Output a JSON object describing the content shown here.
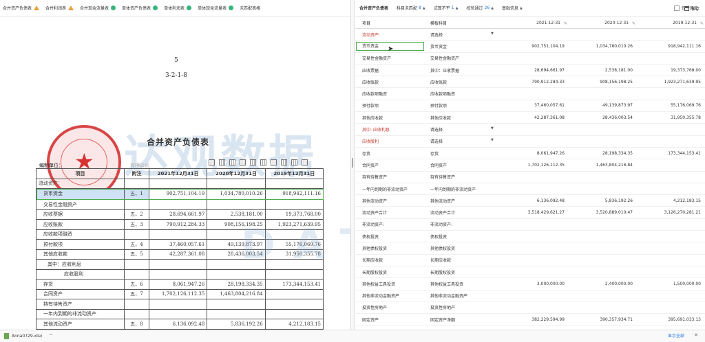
{
  "left_tabs": [
    {
      "label": "合并资产负债表",
      "status": "warning-icon"
    },
    {
      "label": "合并利润表",
      "status": "warning-icon"
    },
    {
      "label": "合并现金流量表",
      "status": "check-icon"
    },
    {
      "label": "单体资产负债表",
      "status": "check-icon"
    },
    {
      "label": "单体利润表",
      "status": "check-icon"
    },
    {
      "label": "单体现金流量表",
      "status": "check-icon"
    },
    {
      "label": "未匹配表格",
      "status": ""
    }
  ],
  "only_original_label": "仅看原文",
  "document": {
    "page_number": "5",
    "page_sub": "3-2-1-8",
    "title": "合并资产负债表",
    "compiled_by": "编制单位：",
    "company_suffix": "有限公司",
    "stamp_number": "3301081080123",
    "headers": [
      "项目",
      "附注",
      "2021年12月31日",
      "2020年12月31日",
      "2019年12月31日"
    ],
    "rows": [
      {
        "item": "流动资产：",
        "note": "",
        "v2021": "",
        "v2020": "",
        "v2019": ""
      },
      {
        "item": "货币资金",
        "note": "五、1",
        "v2021": "902,751,104.19",
        "v2020": "1,034,780,010.26",
        "v2019": "918,942,111.16"
      },
      {
        "item": "交易性金融资产",
        "note": "",
        "v2021": "",
        "v2020": "",
        "v2019": ""
      },
      {
        "item": "应收票据",
        "note": "五、2",
        "v2021": "28,694,661.97",
        "v2020": "2,538,181.00",
        "v2019": "19,373,768.00"
      },
      {
        "item": "应收账款",
        "note": "五、3",
        "v2021": "790,912,284.33",
        "v2020": "908,156,198.25",
        "v2019": "1,923,271,639.95"
      },
      {
        "item": "应收款项融资",
        "note": "",
        "v2021": "",
        "v2020": "",
        "v2019": ""
      },
      {
        "item": "预付款项",
        "note": "五、4",
        "v2021": "37,460,057.61",
        "v2020": "49,139,873.97",
        "v2019": "55,176,069.76"
      },
      {
        "item": "其他应收款",
        "note": "五、5",
        "v2021": "42,287,361.08",
        "v2020": "28,436,003.54",
        "v2019": "31,950,355.78"
      },
      {
        "item": "其中：应收利息",
        "note": "",
        "v2021": "",
        "v2020": "",
        "v2019": ""
      },
      {
        "item": "应收股利",
        "note": "",
        "v2021": "",
        "v2020": "",
        "v2019": ""
      },
      {
        "item": "存货",
        "note": "五、6",
        "v2021": "8,061,947.26",
        "v2020": "28,198,334.35",
        "v2019": "173,344,153.41"
      },
      {
        "item": "合同资产",
        "note": "五、7",
        "v2021": "1,702,126,112.35",
        "v2020": "1,463,804,216.84",
        "v2019": ""
      },
      {
        "item": "持有待售资产",
        "note": "",
        "v2021": "",
        "v2020": "",
        "v2019": ""
      },
      {
        "item": "一年内到期的非流动资产",
        "note": "",
        "v2021": "",
        "v2020": "",
        "v2019": ""
      },
      {
        "item": "其他流动资产",
        "note": "五、8",
        "v2021": "6,136,092.48",
        "v2020": "5,836,192.26",
        "v2019": "4,212,183.15"
      }
    ]
  },
  "watermark": {
    "line1": "达观数据",
    "line2": "DATAGRAND"
  },
  "right_tabs": [
    {
      "label": "合并资产负债表",
      "active": true,
      "caret": false,
      "count": ""
    },
    {
      "label": "科目未匹配",
      "active": false,
      "caret": true,
      "count": "8"
    },
    {
      "label": "试算不平",
      "active": false,
      "caret": true,
      "count": "1"
    },
    {
      "label": "校验通过",
      "active": false,
      "caret": true,
      "count": "26"
    },
    {
      "label": "基础信息",
      "active": false,
      "caret": true,
      "count": ""
    }
  ],
  "save_label": "保存",
  "right_headers": [
    "项目",
    "模板科目",
    "2021-12-31",
    "2020-12-31",
    "2019-12-31"
  ],
  "right_rows": [
    {
      "item": "流动资产:",
      "tpl": "请选择",
      "dd": true,
      "v2021": "",
      "v2020": "",
      "v2019": "",
      "red": true
    },
    {
      "item": "货币资金",
      "tpl": "货币资金",
      "v2021": "902,751,104.19",
      "v2020": "1,034,780,010.26",
      "v2019": "918,942,111.16",
      "selected": true
    },
    {
      "item": "交易性金融资产",
      "tpl": "交易性金融资产",
      "v2021": "",
      "v2020": "",
      "v2019": ""
    },
    {
      "item": "应收票据",
      "tpl": "其中：应收票据",
      "v2021": "28,694,661.97",
      "v2020": "2,538,181.00",
      "v2019": "19,373,768.00"
    },
    {
      "item": "应收账款",
      "tpl": "应收账款",
      "v2021": "790,912,284.33",
      "v2020": "908,156,198.25",
      "v2019": "1,923,271,639.95"
    },
    {
      "item": "应收款项融资",
      "tpl": "应收款项融资",
      "v2021": "",
      "v2020": "",
      "v2019": ""
    },
    {
      "item": "预付款项",
      "tpl": "预付款项",
      "v2021": "37,460,057.61",
      "v2020": "49,139,873.97",
      "v2019": "55,176,069.76"
    },
    {
      "item": "其他应收款",
      "tpl": "其他应收款",
      "v2021": "42,287,361.08",
      "v2020": "28,436,003.54",
      "v2019": "31,950,355.78"
    },
    {
      "item": "其中: 应收利息",
      "tpl": "请选择",
      "dd": true,
      "v2021": "",
      "v2020": "",
      "v2019": "",
      "red": true
    },
    {
      "item": "应收股利",
      "tpl": "请选择",
      "dd": true,
      "v2021": "",
      "v2020": "",
      "v2019": "",
      "red": true
    },
    {
      "item": "存货",
      "tpl": "存货",
      "v2021": "8,061,947.26",
      "v2020": "28,198,334.35",
      "v2019": "173,344,153.41"
    },
    {
      "item": "合同资产",
      "tpl": "合同资产",
      "v2021": "1,702,126,112.35",
      "v2020": "1,463,804,216.84",
      "v2019": ""
    },
    {
      "item": "持有待售资产",
      "tpl": "持有待售资产",
      "v2021": "",
      "v2020": "",
      "v2019": ""
    },
    {
      "item": "一年内到期的非流动资产",
      "tpl": "一年内到期的非流动资产",
      "v2021": "",
      "v2020": "",
      "v2019": ""
    },
    {
      "item": "其他流动资产",
      "tpl": "其他流动资产",
      "v2021": "6,136,092.48",
      "v2020": "5,836,192.26",
      "v2019": "4,212,183.15"
    },
    {
      "item": "流动资产合计",
      "tpl": "流动资产合计",
      "v2021": "3,518,429,621.27",
      "v2020": "3,520,889,010.47",
      "v2019": "3,126,270,281.21"
    },
    {
      "item": "非流动资产:",
      "tpl": "非流动资产:",
      "v2021": "",
      "v2020": "",
      "v2019": ""
    },
    {
      "item": "债权投资",
      "tpl": "债权投资",
      "v2021": "",
      "v2020": "",
      "v2019": ""
    },
    {
      "item": "其他债权投资",
      "tpl": "其他债权投资",
      "v2021": "",
      "v2020": "",
      "v2019": ""
    },
    {
      "item": "长期应收款",
      "tpl": "长期应收款",
      "v2021": "",
      "v2020": "",
      "v2019": ""
    },
    {
      "item": "长期股权投资",
      "tpl": "长期股权投资",
      "v2021": "",
      "v2020": "",
      "v2019": ""
    },
    {
      "item": "其他权益工具投资",
      "tpl": "其他权益工具投资",
      "v2021": "3,000,000.00",
      "v2020": "2,400,000.00",
      "v2019": "1,500,000.00"
    },
    {
      "item": "其他非流动金融资产",
      "tpl": "其他非流动金融资产",
      "v2021": "",
      "v2020": "",
      "v2019": ""
    },
    {
      "item": "投资性房地产",
      "tpl": "投资性房地产",
      "v2021": "",
      "v2020": "",
      "v2019": ""
    },
    {
      "item": "固定资产",
      "tpl": "固定资产净额",
      "v2021": "382,229,594.99",
      "v2020": "390,357,934.71",
      "v2019": "395,691,033.13"
    }
  ],
  "download": {
    "filename": "Anna0729.xlsx",
    "show_all": "显示全部"
  }
}
